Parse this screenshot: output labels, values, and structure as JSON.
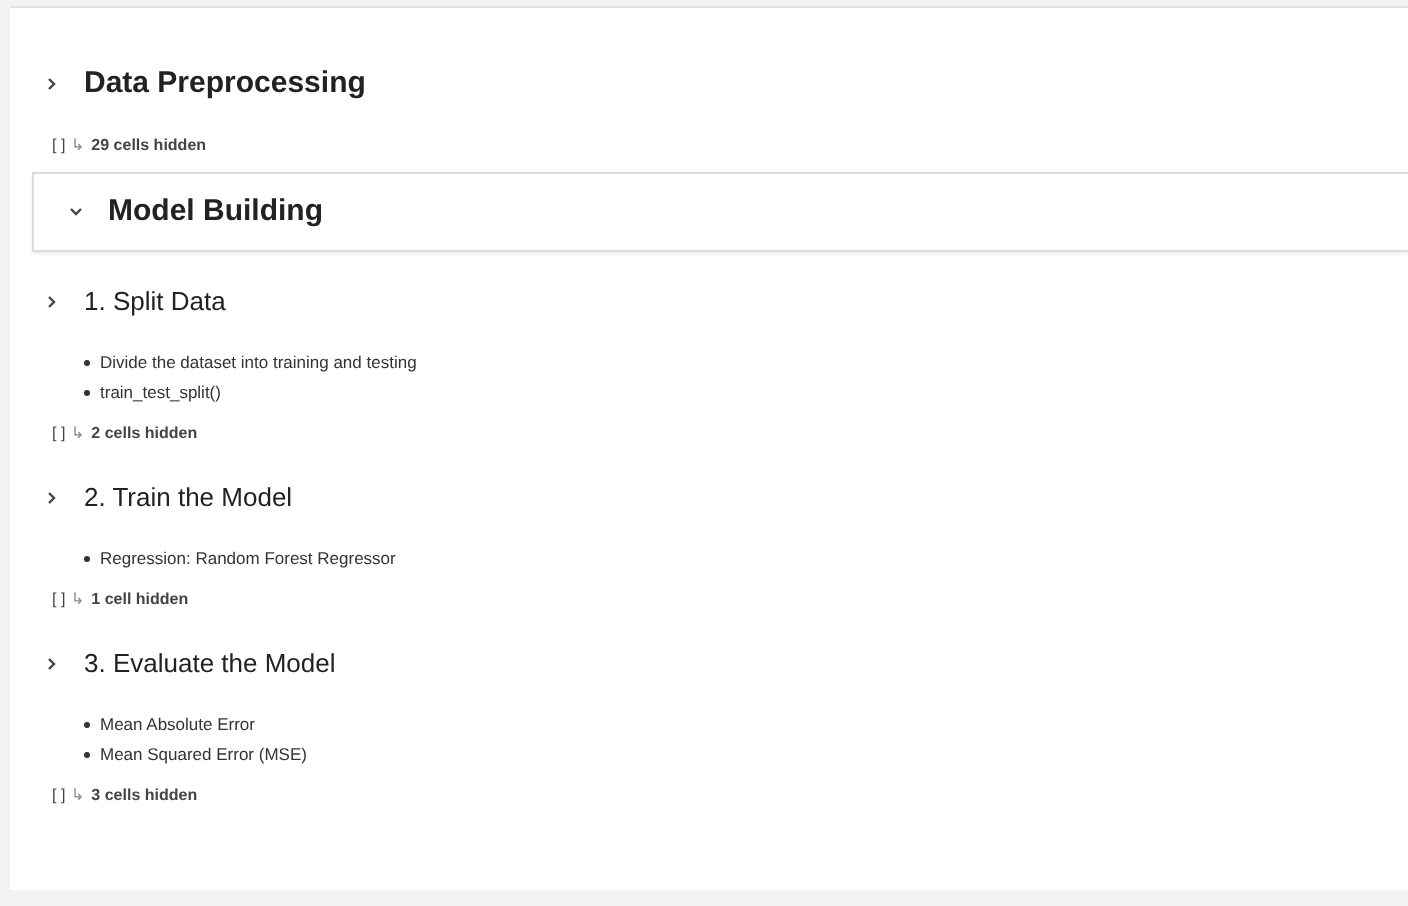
{
  "sections": [
    {
      "kind": "h1",
      "title": "Data Preprocessing",
      "expanded": false,
      "selected": false,
      "hidden": {
        "bracket": "[ ]",
        "arrow": "↳",
        "label": "29 cells hidden"
      }
    },
    {
      "kind": "h1",
      "title": "Model Building",
      "expanded": true,
      "selected": true
    },
    {
      "kind": "h2",
      "title": "1. Split Data",
      "expanded": false,
      "selected": false,
      "bullets": [
        "Divide the dataset into training and testing",
        "train_test_split()"
      ],
      "hidden": {
        "bracket": "[ ]",
        "arrow": "↳",
        "label": "2 cells hidden"
      }
    },
    {
      "kind": "h2",
      "title": "2. Train the Model",
      "expanded": false,
      "selected": false,
      "bullets": [
        "Regression: Random Forest Regressor"
      ],
      "hidden": {
        "bracket": "[ ]",
        "arrow": "↳",
        "label": "1 cell hidden"
      }
    },
    {
      "kind": "h2",
      "title": "3. Evaluate the Model",
      "expanded": false,
      "selected": false,
      "bullets": [
        "Mean Absolute Error",
        "Mean Squared Error (MSE)"
      ],
      "hidden": {
        "bracket": "[ ]",
        "arrow": "↳",
        "label": "3 cells hidden"
      }
    }
  ]
}
